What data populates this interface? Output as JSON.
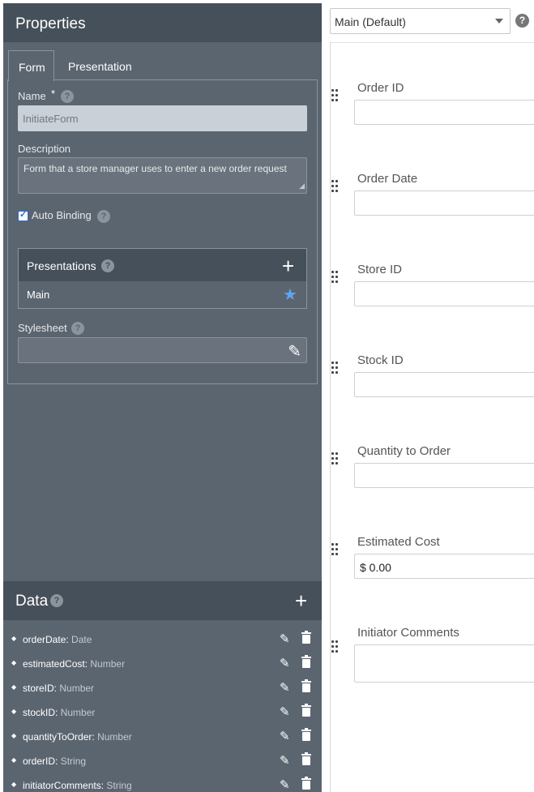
{
  "properties": {
    "title": "Properties",
    "tabs": [
      {
        "label": "Form"
      },
      {
        "label": "Presentation"
      }
    ],
    "name": {
      "label": "Name",
      "required": "*",
      "value": "InitiateForm"
    },
    "description": {
      "label": "Description",
      "value": "Form that a store manager uses to enter a new order request"
    },
    "auto_binding": {
      "label": "Auto Binding",
      "checked": true
    },
    "presentations": {
      "title": "Presentations",
      "add": "+",
      "items": [
        {
          "label": "Main",
          "default": true
        }
      ]
    },
    "stylesheet": {
      "label": "Stylesheet",
      "value": ""
    },
    "help": "?"
  },
  "data": {
    "title": "Data",
    "add": "+",
    "items": [
      {
        "name": "orderDate:",
        "type": "Date"
      },
      {
        "name": "estimatedCost:",
        "type": "Number"
      },
      {
        "name": "storeID:",
        "type": "Number"
      },
      {
        "name": "stockID:",
        "type": "Number"
      },
      {
        "name": "quantityToOrder:",
        "type": "Number"
      },
      {
        "name": "orderID:",
        "type": "String"
      },
      {
        "name": "initiatorComments:",
        "type": "String"
      }
    ]
  },
  "presentation_select": {
    "value": "Main (Default)"
  },
  "form_fields": [
    {
      "label": "Order ID",
      "value": ""
    },
    {
      "label": "Order Date",
      "value": ""
    },
    {
      "label": "Store ID",
      "value": ""
    },
    {
      "label": "Stock ID",
      "value": ""
    },
    {
      "label": "Quantity to Order",
      "value": ""
    },
    {
      "label": "Estimated Cost",
      "value": "$ 0.00"
    },
    {
      "label": "Initiator Comments",
      "value": ""
    }
  ],
  "colors": {
    "panel": "#5b6570",
    "header": "#46505a",
    "accent": "#5ea6f0"
  },
  "icons": {
    "help": "question-circle-icon",
    "add": "plus-icon",
    "default": "star-icon",
    "edit": "pencil-icon",
    "delete": "trash-icon",
    "drag": "drag-handle-icon"
  }
}
